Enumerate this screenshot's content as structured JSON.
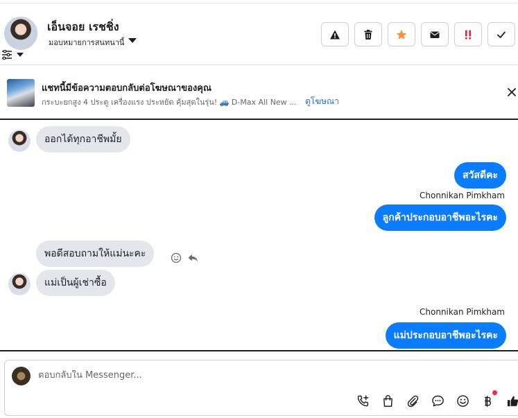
{
  "header": {
    "contact_name": "เอ็นจอย เรชชิ่ง",
    "assign_label": "มอบหมายการสนทนานี้",
    "actions": [
      "spam-report",
      "delete",
      "star",
      "mark-unread",
      "important",
      "done"
    ]
  },
  "ad_banner": {
    "title": "แชทนี้มีข้อความตอบกลับต่อโฆษณาของคุณ",
    "description": "กระบะยกสูง 4 ประตู เครื่องแรง ประหยัด คุ้มสุดในรุ่น! 🚙 D-Max All New ...",
    "link_label": "ดูโฆษณา"
  },
  "messages": [
    {
      "direction": "in",
      "text": "ออกได้ทุกอาชีพมั้ย"
    },
    {
      "direction": "out",
      "text": "สวัสดีคะ"
    },
    {
      "direction": "out",
      "sender": "Chonnikan Pimkham",
      "text": "ลูกค้าประกอบอาชีพอะไรคะ"
    },
    {
      "direction": "in",
      "text": "พอดีสอบถามให้แม่นะคะ"
    },
    {
      "direction": "in",
      "text": "แม่เป็นผู้เช่าซื้อ"
    },
    {
      "direction": "out",
      "sender": "Chonnikan Pimkham",
      "text": "แม่ประกอบอาชีพอะไรคะ"
    }
  ],
  "composer": {
    "placeholder": "ตอบกลับใน Messenger...",
    "tools": [
      "call-add-icon",
      "shopping-bag-icon",
      "paperclip-icon",
      "saved-reply-icon",
      "emoji-icon",
      "baht-payment-icon",
      "like-icon"
    ]
  },
  "colors": {
    "accent": "#0a7cff",
    "link": "#216fdb",
    "incoming_bubble": "#e4e6eb",
    "star": "#f7923a",
    "important": "#e41e3f",
    "notification_dot": "#f02849"
  }
}
